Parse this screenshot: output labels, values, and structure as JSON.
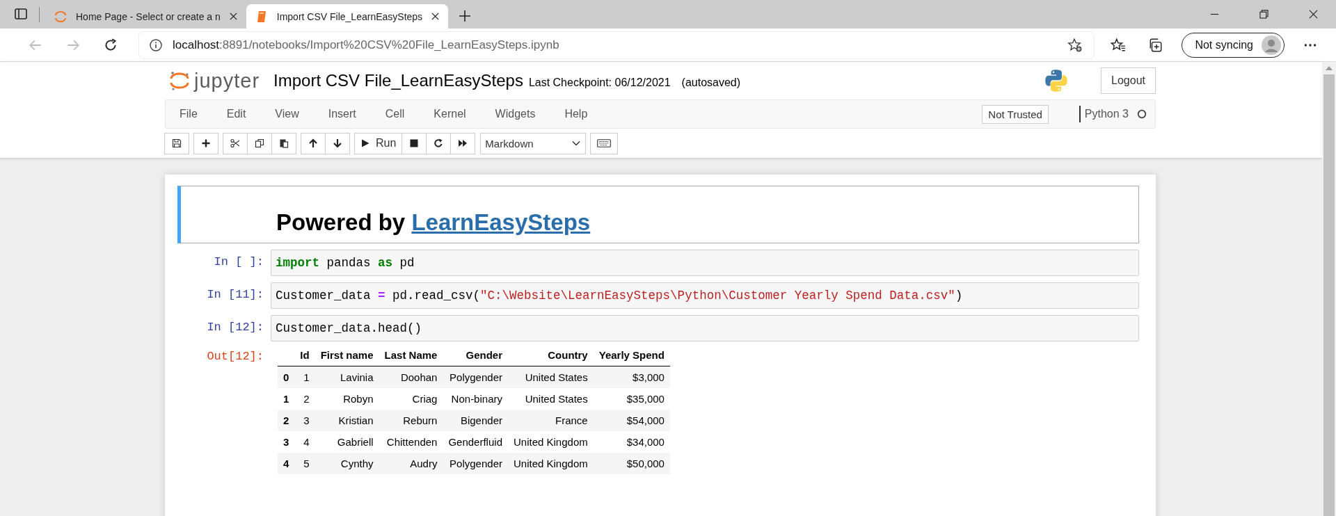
{
  "browser": {
    "tabs": [
      {
        "title": "Home Page - Select or create a n",
        "selected": false
      },
      {
        "title": "Import CSV File_LearnEasySteps",
        "selected": true
      }
    ],
    "url_host": "localhost",
    "url_path": ":8891/notebooks/Import%20CSV%20File_LearnEasySteps.ipynb",
    "sync_button": "Not syncing"
  },
  "notebook": {
    "logo_text": "jupyter",
    "title": "Import CSV File_LearnEasySteps",
    "checkpoint": "Last Checkpoint: 06/12/2021",
    "autosave": "(autosaved)",
    "logout": "Logout",
    "menu": [
      "File",
      "Edit",
      "View",
      "Insert",
      "Cell",
      "Kernel",
      "Widgets",
      "Help"
    ],
    "trust": "Not Trusted",
    "kernel": "Python 3",
    "run": "Run",
    "cell_type": "Markdown"
  },
  "cells": [
    {
      "kind": "markdown",
      "selected": true,
      "heading": "Powered by ",
      "link": "LearnEasySteps"
    },
    {
      "kind": "code",
      "selected": false,
      "prompt": "In [ ]:",
      "tokens": [
        {
          "kind": "kw",
          "text": "import"
        },
        {
          "kind": "plain",
          "text": " pandas "
        },
        {
          "kind": "kw",
          "text": "as"
        },
        {
          "kind": "plain",
          "text": " pd"
        }
      ]
    },
    {
      "kind": "code",
      "selected": false,
      "prompt": "In [11]:",
      "tokens": [
        {
          "kind": "plain",
          "text": "Customer_data "
        },
        {
          "kind": "op",
          "text": "="
        },
        {
          "kind": "plain",
          "text": " pd.read_csv("
        },
        {
          "kind": "str",
          "text": "\"C:\\Website\\LearnEasySteps\\Python\\Customer Yearly Spend Data.csv\""
        },
        {
          "kind": "plain",
          "text": ")"
        }
      ]
    },
    {
      "kind": "code",
      "selected": false,
      "prompt": "In [12]:",
      "tokens": [
        {
          "kind": "plain",
          "text": "Customer_data.head()"
        }
      ]
    }
  ],
  "output": {
    "prompt": "Out[12]:",
    "columns": [
      "Id",
      "First name",
      "Last Name",
      "Gender",
      "Country",
      "Yearly Spend"
    ],
    "rows": [
      {
        "index": "0",
        "cells": [
          "1",
          "Lavinia",
          "Doohan",
          "Polygender",
          "United States",
          "$3,000"
        ]
      },
      {
        "index": "1",
        "cells": [
          "2",
          "Robyn",
          "Criag",
          "Non-binary",
          "United States",
          "$35,000"
        ]
      },
      {
        "index": "2",
        "cells": [
          "3",
          "Kristian",
          "Reburn",
          "Bigender",
          "France",
          "$54,000"
        ]
      },
      {
        "index": "3",
        "cells": [
          "4",
          "Gabriell",
          "Chittenden",
          "Genderfluid",
          "United Kingdom",
          "$34,000"
        ]
      },
      {
        "index": "4",
        "cells": [
          "5",
          "Cynthy",
          "Audry",
          "Polygender",
          "United Kingdom",
          "$50,000"
        ]
      }
    ]
  }
}
